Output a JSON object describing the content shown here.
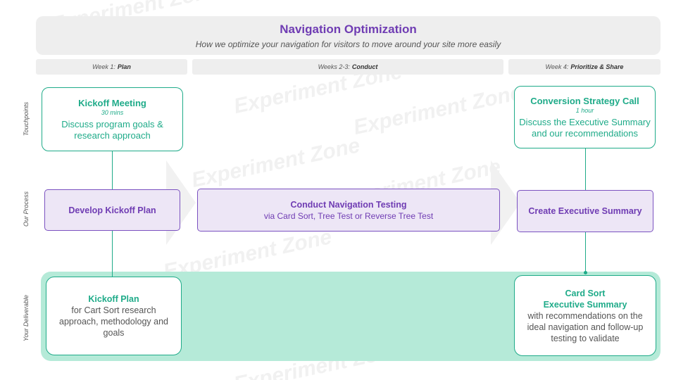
{
  "header": {
    "title": "Navigation Optimization",
    "subtitle": "How we optimize your navigation for visitors to move around your site more easily"
  },
  "weeks": [
    {
      "prefix": "Week 1:",
      "name": "Plan"
    },
    {
      "prefix": "Weeks 2-3:",
      "name": "Conduct"
    },
    {
      "prefix": "Week 4:",
      "name": "Prioritize & Share"
    }
  ],
  "rows": {
    "touchpoints": "Touchpoints",
    "process": "Our Process",
    "deliverable": "Your Deliverable"
  },
  "touchpoints": {
    "kickoff": {
      "title": "Kickoff Meeting",
      "duration": "30 mins",
      "body": "Discuss program goals & research approach"
    },
    "strategy": {
      "title": "Conversion Strategy Call",
      "duration": "1 hour",
      "body": "Discuss the Executive Summary and our recommendations"
    }
  },
  "process": {
    "plan": {
      "title": "Develop Kickoff Plan"
    },
    "conduct": {
      "title": "Conduct Navigation Testing",
      "subtitle": "via Card Sort, Tree Test or Reverse Tree Test"
    },
    "summary": {
      "title": "Create Executive Summary"
    }
  },
  "deliverables": {
    "plan": {
      "title": "Kickoff Plan",
      "body": "for Cart Sort research approach, methodology and goals"
    },
    "summary": {
      "title_line1": "Card Sort",
      "title_line2": "Executive Summary",
      "body": "with recommendations on the ideal navigation and follow-up testing to validate"
    }
  },
  "watermark": "Experiment Zone",
  "colors": {
    "purple": "#6f3cb3",
    "green": "#1fab89",
    "band": "#b5ead8",
    "gray": "#eeeeee"
  }
}
